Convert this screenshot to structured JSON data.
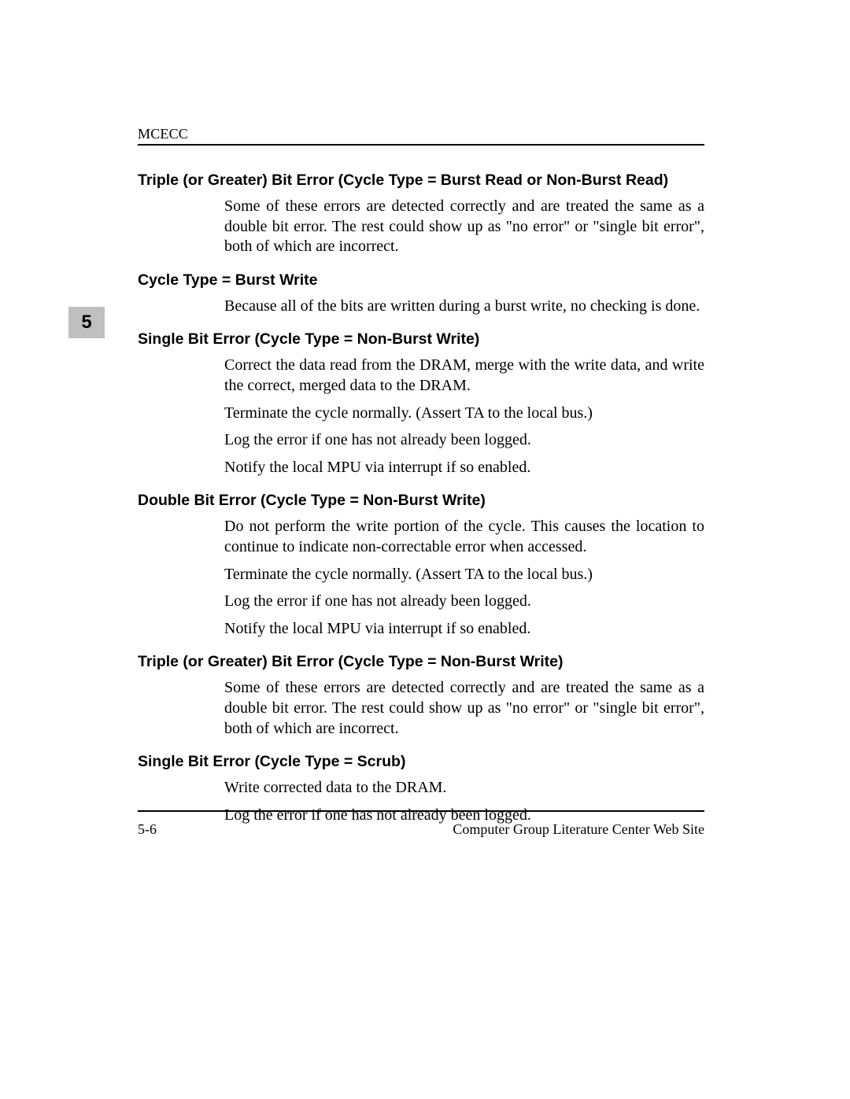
{
  "chapter_number": "5",
  "running_head": "MCECC",
  "sections": [
    {
      "heading": "Triple (or Greater) Bit Error (Cycle Type = Burst Read or Non-Burst Read)",
      "paragraphs": [
        "Some of these errors are detected correctly and are treated the same as a double bit error. The rest could show up as \"no error\" or \"single bit error\", both of which are incorrect."
      ]
    },
    {
      "heading": "Cycle Type = Burst Write",
      "paragraphs": [
        "Because all of the bits are written during a burst write, no checking is done."
      ]
    },
    {
      "heading": "Single Bit Error (Cycle Type = Non-Burst Write)",
      "paragraphs": [
        "Correct the data read from the DRAM, merge with the write data, and write the correct, merged data to the DRAM.",
        "Terminate the cycle normally. (Assert TA to the local bus.)",
        "Log the error if one has not already been logged.",
        "Notify the local MPU via interrupt if so enabled."
      ]
    },
    {
      "heading": "Double Bit Error (Cycle Type = Non-Burst Write)",
      "paragraphs": [
        "Do not perform the write portion of the cycle. This causes the location to continue to indicate non-correctable error when accessed.",
        "Terminate the cycle normally. (Assert TA to the local bus.)",
        "Log the error if one has not already been logged.",
        "Notify the local MPU via interrupt if so enabled."
      ]
    },
    {
      "heading": "Triple (or Greater) Bit Error (Cycle Type = Non-Burst Write)",
      "paragraphs": [
        "Some of these errors are detected correctly and are treated the same as a double bit error. The rest could show up as \"no error\" or \"single bit error\", both of which are incorrect."
      ]
    },
    {
      "heading": "Single Bit Error (Cycle Type = Scrub)",
      "paragraphs": [
        "Write corrected data to the DRAM.",
        "Log the error if one has not already been logged."
      ]
    }
  ],
  "footer": {
    "page_number": "5-6",
    "site": "Computer Group Literature Center Web Site"
  }
}
